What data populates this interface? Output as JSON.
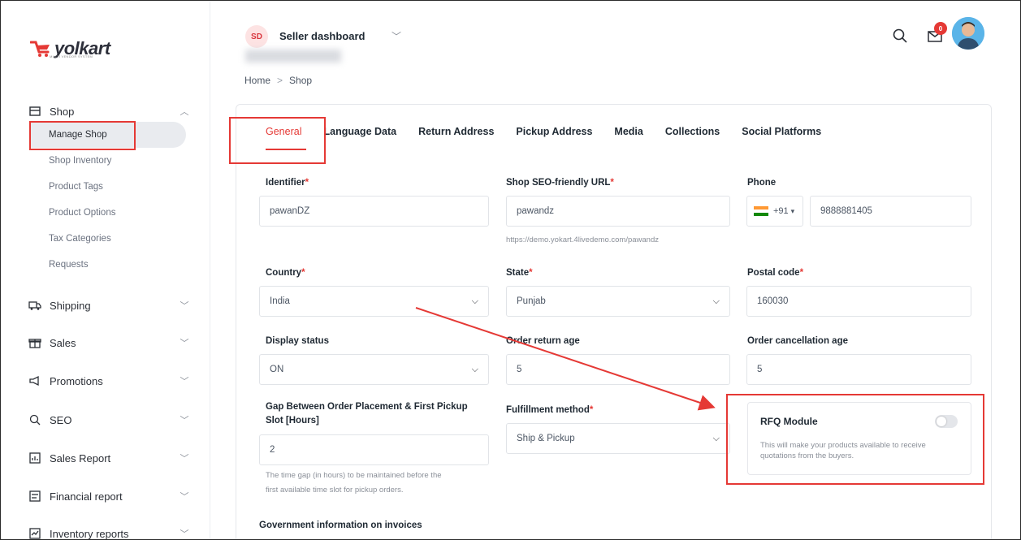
{
  "brand": {
    "name": "yolkart",
    "tagline": "MULTI VENDOR SYSTEM",
    "accent": "#e53935"
  },
  "sidebar": {
    "shop": {
      "label": "Shop",
      "chevron": "^"
    },
    "shop_items": [
      {
        "label": "Manage Shop"
      },
      {
        "label": "Shop Inventory"
      },
      {
        "label": "Product Tags"
      },
      {
        "label": "Product Options"
      },
      {
        "label": "Tax Categories"
      },
      {
        "label": "Requests"
      }
    ],
    "sections": [
      {
        "label": "Shipping",
        "icon": "truck-icon"
      },
      {
        "label": "Sales",
        "icon": "gift-icon"
      },
      {
        "label": "Promotions",
        "icon": "megaphone-icon"
      },
      {
        "label": "SEO",
        "icon": "seo-icon"
      },
      {
        "label": "Sales Report",
        "icon": "report-icon"
      },
      {
        "label": "Financial report",
        "icon": "finance-icon"
      },
      {
        "label": "Inventory reports",
        "icon": "inventory-icon"
      }
    ]
  },
  "header": {
    "badge": "SD",
    "title": "Seller dashboard",
    "notification_count": "0"
  },
  "breadcrumb": {
    "home": "Home",
    "sep": ">",
    "current": "Shop"
  },
  "tabs": [
    "General",
    "Language Data",
    "Return Address",
    "Pickup Address",
    "Media",
    "Collections",
    "Social Platforms"
  ],
  "form": {
    "identifier": {
      "label": "Identifier",
      "value": "pawanDZ"
    },
    "seo_url": {
      "label": "Shop SEO-friendly URL",
      "value": "pawandz",
      "help": "https://demo.yokart.4livedemo.com/pawandz"
    },
    "phone": {
      "label": "Phone",
      "code": "+91",
      "value": "9888881405"
    },
    "country": {
      "label": "Country",
      "value": "India"
    },
    "state": {
      "label": "State",
      "value": "Punjab"
    },
    "postal": {
      "label": "Postal code",
      "value": "160030"
    },
    "display_status": {
      "label": "Display status",
      "value": "ON"
    },
    "return_age": {
      "label": "Order return age",
      "value": "5"
    },
    "cancel_age": {
      "label": "Order cancellation age",
      "value": "5"
    },
    "gap": {
      "label_line1": "Gap Between Order Placement & First Pickup",
      "label_line2": "Slot [Hours]",
      "value": "2",
      "help_line1": "The time gap (in hours) to be maintained before the",
      "help_line2": "first available time slot for pickup orders."
    },
    "fulfillment": {
      "label": "Fulfillment method",
      "value": "Ship & Pickup"
    },
    "rfq": {
      "title": "RFQ Module",
      "desc": "This will make your products available to receive quotations from the buyers.",
      "enabled": false
    },
    "gov_info": {
      "label": "Government information on invoices"
    }
  },
  "required_marker": "*"
}
